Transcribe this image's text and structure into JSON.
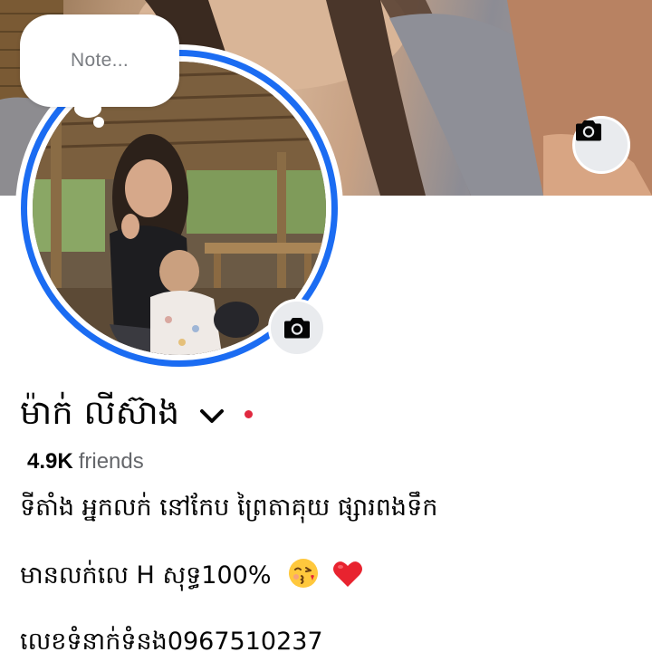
{
  "note": {
    "placeholder": "Note..."
  },
  "profile": {
    "name": "ម៉ាក់ លីស៊ាង",
    "friends_count": "4.9K",
    "friends_label": "friends",
    "status_color": "#e0293f",
    "ring_color": "#1b6cf2"
  },
  "bio": {
    "line1": "ទីតាំង អ្នកលក់ នៅកែប ព្រៃតាគុយ ផ្សារពងទឹក",
    "line2": "មានលក់លេ H សុទ្ធ100%",
    "line3": "លេខទំនាក់ទំនង0967510237"
  },
  "icons": {
    "cover_camera": "camera-icon",
    "avatar_camera": "camera-icon",
    "name_menu": "chevron-down-icon",
    "emoji1": "face-blowing-kiss-icon",
    "emoji2": "red-heart-icon"
  }
}
